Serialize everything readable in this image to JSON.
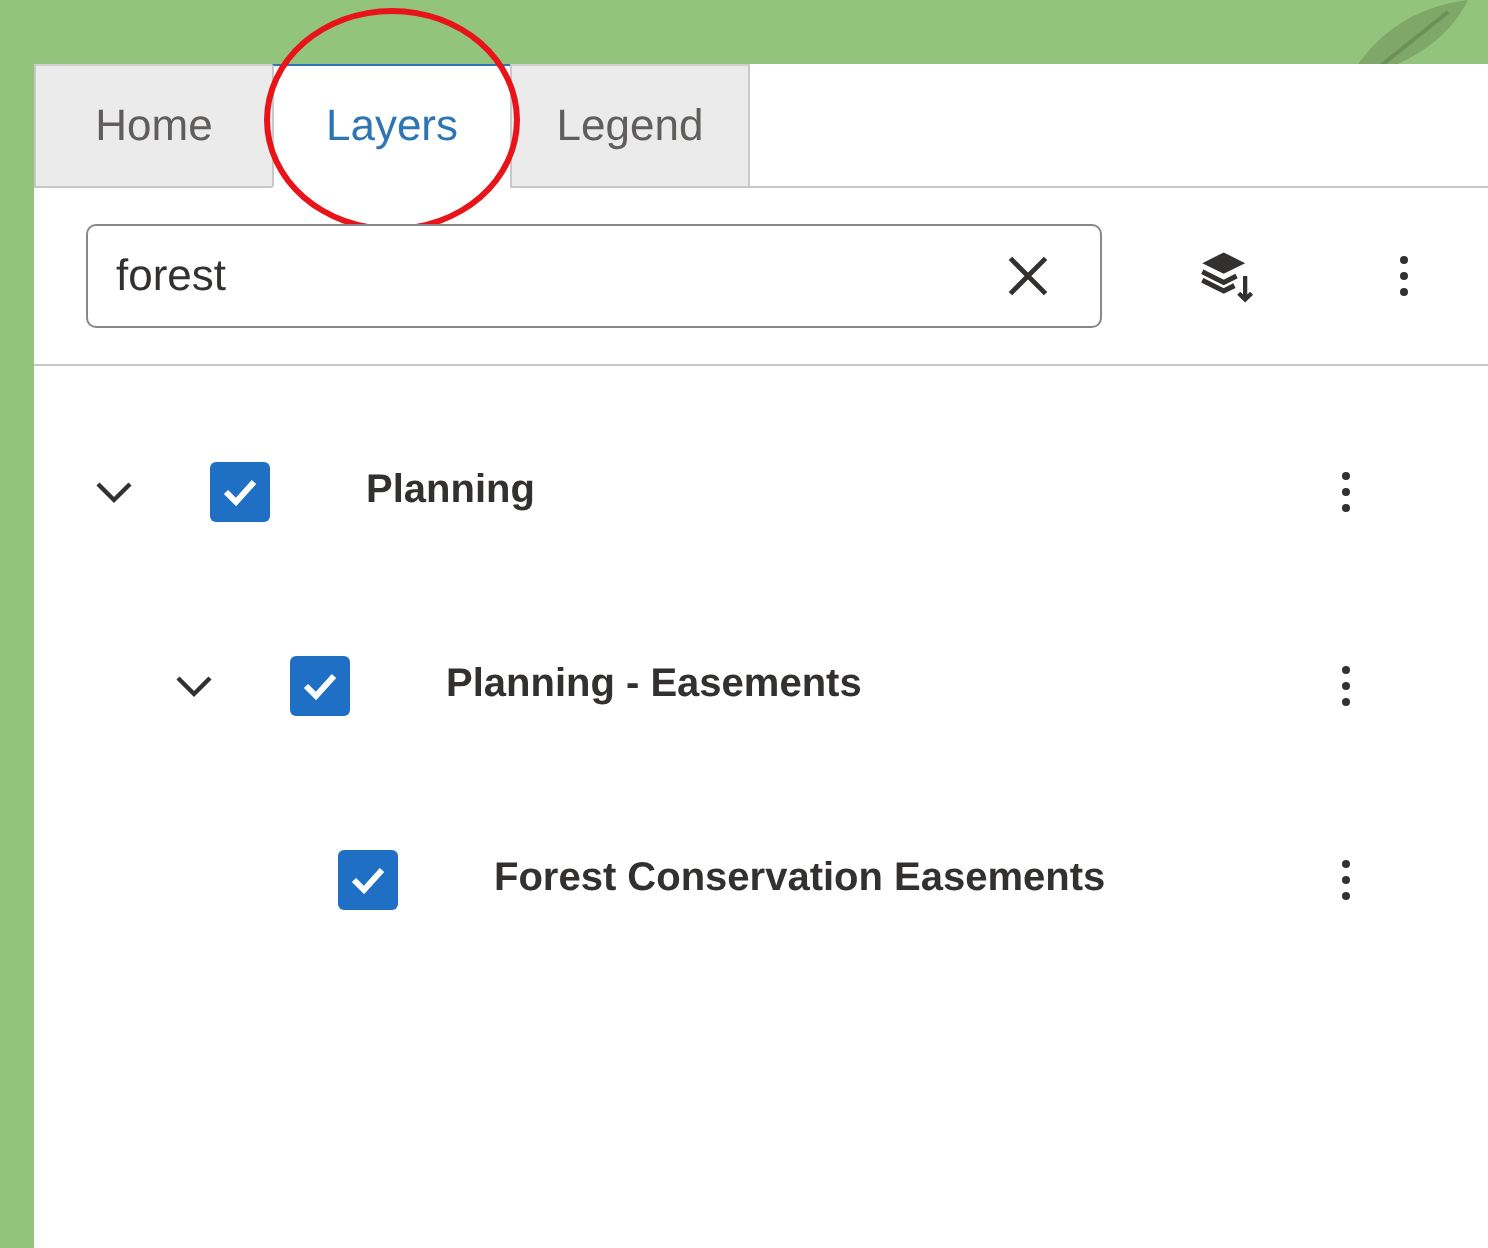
{
  "tabs": [
    {
      "label": "Home",
      "selected": false,
      "circled": false
    },
    {
      "label": "Layers",
      "selected": true,
      "circled": true
    },
    {
      "label": "Legend",
      "selected": false,
      "circled": false
    }
  ],
  "search": {
    "value": "forest"
  },
  "layers": [
    {
      "label": "Planning",
      "checked": true,
      "expanded": true,
      "children": [
        {
          "label": "Planning - Easements",
          "checked": true,
          "expanded": true,
          "children": [
            {
              "label": "Forest Conservation Easements",
              "checked": true
            }
          ]
        }
      ]
    }
  ]
}
